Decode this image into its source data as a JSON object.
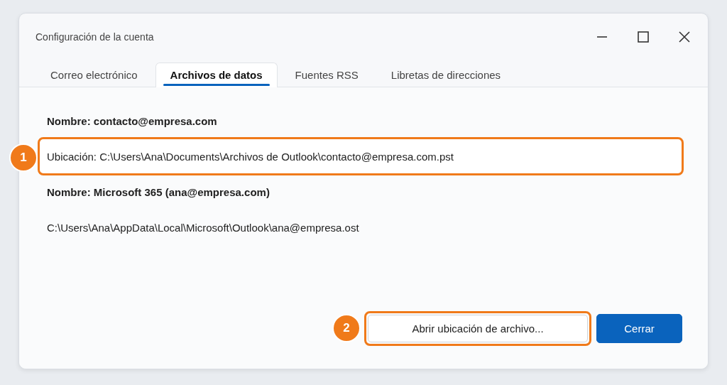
{
  "window": {
    "title": "Configuración de la cuenta"
  },
  "tabs": [
    {
      "label": "Correo electrónico",
      "selected": false
    },
    {
      "label": "Archivos de datos",
      "selected": true
    },
    {
      "label": "Fuentes RSS",
      "selected": false
    },
    {
      "label": "Libretas de direcciones",
      "selected": false
    }
  ],
  "lines": [
    {
      "kind": "name",
      "text": "Nombre: contacto@empresa.com"
    },
    {
      "kind": "path",
      "text": "Ubicación: C:\\Users\\Ana\\Documents\\Archivos de Outlook\\contacto@empresa.com.pst",
      "callout": "1"
    },
    {
      "kind": "name",
      "text": "Nombre: Microsoft 365 (ana@empresa.com)"
    },
    {
      "kind": "path",
      "text": "C:\\Users\\Ana\\AppData\\Local\\Microsoft\\Outlook\\ana@empresa.ost"
    }
  ],
  "buttons": [
    {
      "kind": "secondary",
      "label": "Abrir ubicación de archivo...",
      "callout": "2"
    },
    {
      "kind": "primary",
      "label": "Cerrar"
    }
  ]
}
